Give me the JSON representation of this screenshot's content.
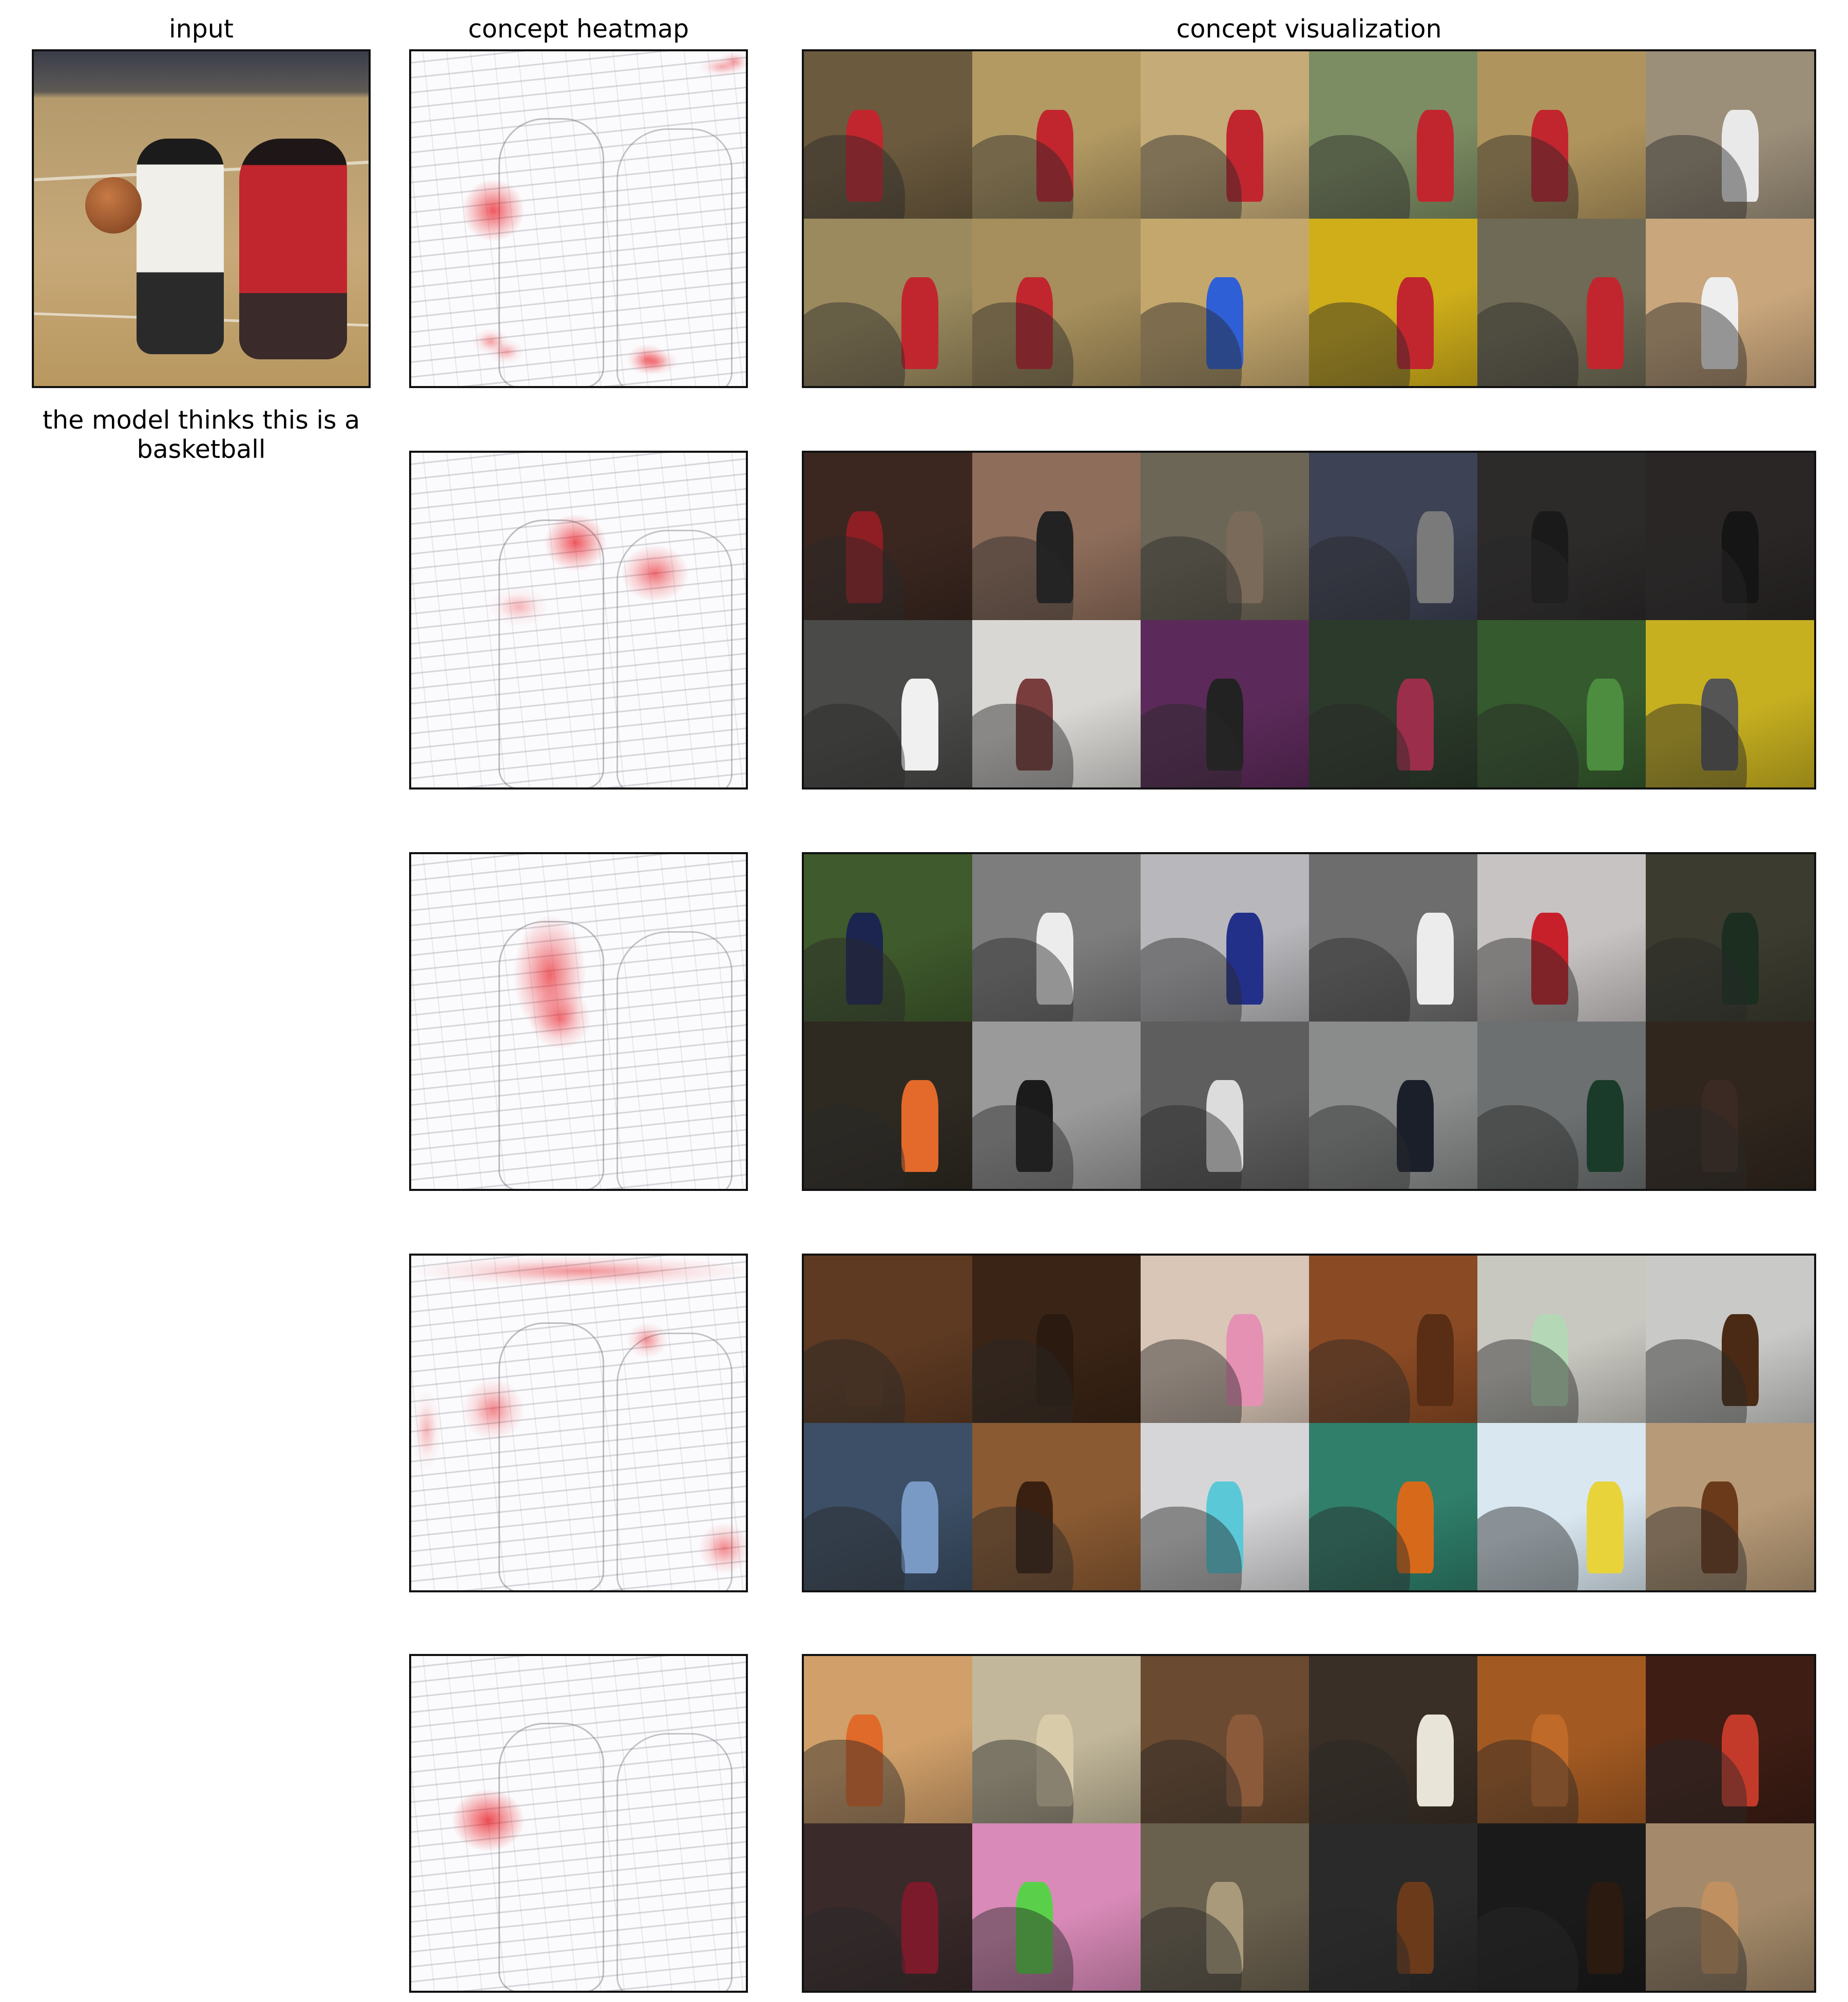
{
  "titles": {
    "input": "input",
    "heatmap": "concept heatmap",
    "visualization": "concept visualization"
  },
  "caption": "the model thinks this is a basketball",
  "input_image": {
    "label": "basketball players photo"
  },
  "concepts": [
    {
      "heat_color": "#e8141c",
      "heat_blobs": [
        {
          "kind": "ball"
        },
        {
          "kind": "shoes"
        },
        {
          "kind": "top-edge"
        }
      ],
      "tiles": [
        "#6b5a3e",
        "#b39a63",
        "#c5ab78",
        "#7d8d63",
        "#b0945d",
        "#9c8f7a",
        "#9a8a5e",
        "#a68f5c",
        "#c4a76d",
        "#cfae1a",
        "#6f6a55",
        "#c9a67c"
      ],
      "figure_colors": [
        "#c1262e",
        "#c1262e",
        "#c1262e",
        "#c1262e",
        "#c1262e",
        "#e9e9e9",
        "#c1262e",
        "#c1262e",
        "#2e5fd6",
        "#c1262e",
        "#c1262e",
        "#eeeeee"
      ]
    },
    {
      "heat_color": "#e8141c",
      "heat_blobs": [
        {
          "kind": "heads"
        }
      ],
      "tiles": [
        "#3b2720",
        "#8e6d5b",
        "#6c6656",
        "#3d4254",
        "#2d2a2a",
        "#2a2626",
        "#4a4a48",
        "#d9d7d4",
        "#5c2a5a",
        "#2b3a2a",
        "#355a2d",
        "#c7b020"
      ],
      "figure_colors": [
        "#8e1e23",
        "#222222",
        "#7a6a5a",
        "#7a7a7a",
        "#1a1a1a",
        "#151515",
        "#f0f0f0",
        "#7a3d3d",
        "#222222",
        "#9b2e4a",
        "#4c8d3f",
        "#555555"
      ]
    },
    {
      "heat_color": "#e8141c",
      "heat_blobs": [
        {
          "kind": "jersey"
        }
      ],
      "tiles": [
        "#3f5a2c",
        "#7d7d7d",
        "#b8b8bc",
        "#6d6d6d",
        "#c7c3c2",
        "#3b3b2f",
        "#2e2a22",
        "#9a9a9a",
        "#5e5e5e",
        "#8a8c8c",
        "#6c7070",
        "#30261e"
      ],
      "figure_colors": [
        "#1c2550",
        "#ececec",
        "#23308a",
        "#ececec",
        "#c7202a",
        "#1b2e1f",
        "#e36a2a",
        "#1b1b1b",
        "#dcdcdc",
        "#1a1f2a",
        "#1b3b2a",
        "#3b2a24"
      ]
    },
    {
      "heat_color": "#e8141c",
      "heat_blobs": [
        {
          "kind": "floor"
        }
      ],
      "tiles": [
        "#5e3a22",
        "#3a2415",
        "#d9c6b7",
        "#8a4a24",
        "#c8c7c0",
        "#c9c9c7",
        "#3c4f66",
        "#8a5a32",
        "#d6d6d8",
        "#2f7f6b",
        "#d9e7f0",
        "#b79a77"
      ],
      "figure_colors": [
        "#5e3a22",
        "#2a1a10",
        "#e591b4",
        "#5a2e14",
        "#b4d8b6",
        "#4a2a14",
        "#7a9ac6",
        "#3a2010",
        "#5bc8d8",
        "#d66a1a",
        "#e8d43a",
        "#6a3a1a"
      ]
    },
    {
      "heat_color": "#e8141c",
      "heat_blobs": [
        {
          "kind": "ball-only"
        }
      ],
      "tiles": [
        "#d1a06a",
        "#c2b79a",
        "#6a4a30",
        "#3a2f26",
        "#a35a22",
        "#3d1d14",
        "#3a2a2a",
        "#d98ab8",
        "#6a604e",
        "#2a2a2a",
        "#1a1a1a",
        "#a48a6a"
      ],
      "figure_colors": [
        "#e06a2a",
        "#d8cbaa",
        "#8a5a3a",
        "#e8e4d8",
        "#c06a2a",
        "#c43a2a",
        "#7a1a2a",
        "#5ad04a",
        "#a89a7a",
        "#6a3a1a",
        "#2a1a10",
        "#c09060"
      ]
    }
  ]
}
